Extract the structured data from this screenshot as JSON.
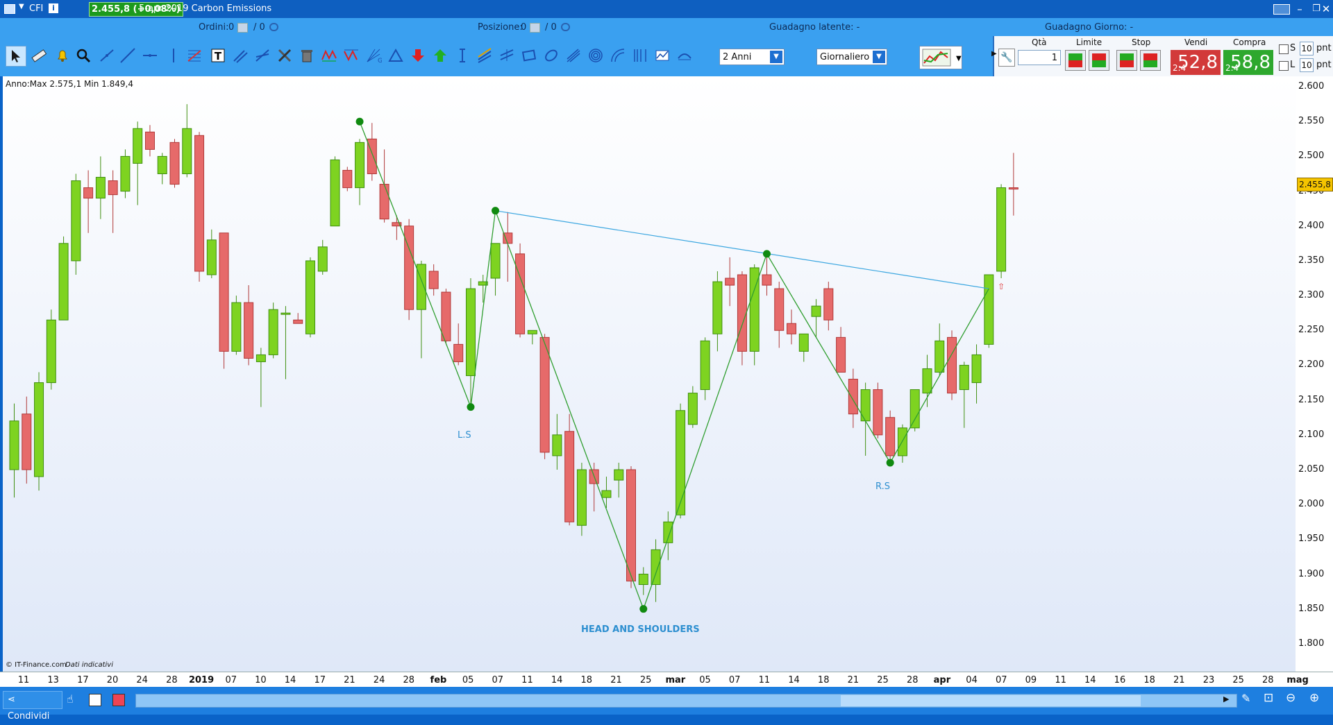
{
  "titlebar": {
    "symbol": "CFI",
    "price_change": "2.455,8 (+0,08%)",
    "instrument": "5-apr-2019 Carbon Emissions"
  },
  "infobar": {
    "orders_label": "Ordini:",
    "orders_value": "0",
    "orders_total": "/ 0",
    "position_label": "Posizione:",
    "position_value": "0",
    "position_total": "/ 0",
    "latent_gain": "Guadagno latente: -",
    "day_gain": "Guadagno Giorno: -"
  },
  "toolbar": {
    "period": "2 Anni",
    "timeframe": "Giornaliero"
  },
  "trade": {
    "qty_label": "Qtà",
    "qty_value": "1",
    "limit_label": "Limite",
    "stop_label": "Stop",
    "sell_label": "Vendi",
    "buy_label": "Compra",
    "sell_prefix": "2.4",
    "sell_price": "52,8",
    "buy_prefix": "2.4",
    "buy_price": "58,8",
    "s_label": "S",
    "l_label": "L",
    "s_pnt": "10",
    "l_pnt": "10",
    "pnt_label": "pnt"
  },
  "chart": {
    "info": "Anno:Max 2.575,1 Min 1.849,4",
    "copyright": "© IT-Finance.com",
    "disclaimer": "Dati indicativi",
    "last_price": "2.455,8",
    "annotations": {
      "ls": "L.S",
      "rs": "R.S",
      "pattern": "HEAD AND SHOULDERS"
    },
    "colors": {
      "up": "#7ed321",
      "down": "#e66a6a",
      "pattern": "#2f9e2f",
      "neckline": "#3aa6e0"
    }
  },
  "chart_data": {
    "type": "candlestick",
    "y_ticks": [
      "2.600",
      "2.550",
      "2.500",
      "2.450",
      "2.400",
      "2.350",
      "2.300",
      "2.250",
      "2.200",
      "2.150",
      "2.100",
      "2.050",
      "2.000",
      "1.950",
      "1.900",
      "1.850",
      "1.800"
    ],
    "ylim": [
      1760,
      2615
    ],
    "x_ticks": [
      "11",
      "13",
      "17",
      "20",
      "24",
      "28",
      "2019",
      "07",
      "10",
      "14",
      "17",
      "21",
      "24",
      "28",
      "feb",
      "05",
      "07",
      "11",
      "14",
      "18",
      "21",
      "25",
      "mar",
      "05",
      "07",
      "11",
      "14",
      "18",
      "21",
      "25",
      "28",
      "apr",
      "04",
      "07",
      "09",
      "11",
      "14",
      "16",
      "18",
      "21",
      "23",
      "25",
      "28",
      "mag"
    ],
    "candles": [
      {
        "o": 2050,
        "h": 2145,
        "l": 2010,
        "c": 2120
      },
      {
        "o": 2130,
        "h": 2155,
        "l": 2030,
        "c": 2050
      },
      {
        "o": 2040,
        "h": 2190,
        "l": 2020,
        "c": 2175
      },
      {
        "o": 2175,
        "h": 2280,
        "l": 2165,
        "c": 2265
      },
      {
        "o": 2265,
        "h": 2385,
        "l": 2265,
        "c": 2375
      },
      {
        "o": 2350,
        "h": 2475,
        "l": 2330,
        "c": 2465
      },
      {
        "o": 2455,
        "h": 2480,
        "l": 2390,
        "c": 2440
      },
      {
        "o": 2440,
        "h": 2500,
        "l": 2410,
        "c": 2470
      },
      {
        "o": 2465,
        "h": 2480,
        "l": 2390,
        "c": 2445
      },
      {
        "o": 2450,
        "h": 2510,
        "l": 2440,
        "c": 2500
      },
      {
        "o": 2490,
        "h": 2550,
        "l": 2430,
        "c": 2540
      },
      {
        "o": 2535,
        "h": 2545,
        "l": 2500,
        "c": 2510
      },
      {
        "o": 2475,
        "h": 2505,
        "l": 2460,
        "c": 2500
      },
      {
        "o": 2520,
        "h": 2525,
        "l": 2455,
        "c": 2460
      },
      {
        "o": 2475,
        "h": 2575,
        "l": 2470,
        "c": 2540
      },
      {
        "o": 2530,
        "h": 2535,
        "l": 2320,
        "c": 2335
      },
      {
        "o": 2330,
        "h": 2395,
        "l": 2325,
        "c": 2380
      },
      {
        "o": 2390,
        "h": 2390,
        "l": 2195,
        "c": 2220
      },
      {
        "o": 2220,
        "h": 2300,
        "l": 2215,
        "c": 2290
      },
      {
        "o": 2290,
        "h": 2315,
        "l": 2200,
        "c": 2210
      },
      {
        "o": 2205,
        "h": 2225,
        "l": 2140,
        "c": 2215
      },
      {
        "o": 2215,
        "h": 2290,
        "l": 2210,
        "c": 2280
      },
      {
        "o": 2275,
        "h": 2285,
        "l": 2180,
        "c": 2275
      },
      {
        "o": 2265,
        "h": 2275,
        "l": 2260,
        "c": 2260
      },
      {
        "o": 2245,
        "h": 2355,
        "l": 2240,
        "c": 2350
      },
      {
        "o": 2335,
        "h": 2380,
        "l": 2330,
        "c": 2370
      },
      {
        "o": 2400,
        "h": 2500,
        "l": 2400,
        "c": 2495
      },
      {
        "o": 2480,
        "h": 2485,
        "l": 2450,
        "c": 2455
      },
      {
        "o": 2455,
        "h": 2525,
        "l": 2430,
        "c": 2520
      },
      {
        "o": 2525,
        "h": 2548,
        "l": 2465,
        "c": 2475
      },
      {
        "o": 2460,
        "h": 2510,
        "l": 2405,
        "c": 2410
      },
      {
        "o": 2405,
        "h": 2415,
        "l": 2380,
        "c": 2400
      },
      {
        "o": 2400,
        "h": 2410,
        "l": 2265,
        "c": 2280
      },
      {
        "o": 2280,
        "h": 2350,
        "l": 2210,
        "c": 2345
      },
      {
        "o": 2335,
        "h": 2345,
        "l": 2300,
        "c": 2310
      },
      {
        "o": 2305,
        "h": 2310,
        "l": 2230,
        "c": 2235
      },
      {
        "o": 2230,
        "h": 2260,
        "l": 2200,
        "c": 2205
      },
      {
        "o": 2185,
        "h": 2325,
        "l": 2140,
        "c": 2310
      },
      {
        "o": 2315,
        "h": 2330,
        "l": 2290,
        "c": 2320
      },
      {
        "o": 2325,
        "h": 2365,
        "l": 2300,
        "c": 2375
      },
      {
        "o": 2390,
        "h": 2420,
        "l": 2320,
        "c": 2375
      },
      {
        "o": 2360,
        "h": 2375,
        "l": 2240,
        "c": 2245
      },
      {
        "o": 2245,
        "h": 2250,
        "l": 2230,
        "c": 2250
      },
      {
        "o": 2240,
        "h": 2245,
        "l": 2065,
        "c": 2075
      },
      {
        "o": 2070,
        "h": 2130,
        "l": 2050,
        "c": 2100
      },
      {
        "o": 2105,
        "h": 2130,
        "l": 1970,
        "c": 1975
      },
      {
        "o": 1970,
        "h": 2060,
        "l": 1955,
        "c": 2050
      },
      {
        "o": 2050,
        "h": 2060,
        "l": 1990,
        "c": 2030
      },
      {
        "o": 2010,
        "h": 2040,
        "l": 1995,
        "c": 2020
      },
      {
        "o": 2035,
        "h": 2060,
        "l": 2010,
        "c": 2050
      },
      {
        "o": 2050,
        "h": 2055,
        "l": 1880,
        "c": 1890
      },
      {
        "o": 1885,
        "h": 1910,
        "l": 1870,
        "c": 1900
      },
      {
        "o": 1885,
        "h": 1950,
        "l": 1860,
        "c": 1935
      },
      {
        "o": 1945,
        "h": 1990,
        "l": 1920,
        "c": 1975
      },
      {
        "o": 1985,
        "h": 2145,
        "l": 1980,
        "c": 2135
      },
      {
        "o": 2115,
        "h": 2170,
        "l": 2110,
        "c": 2160
      },
      {
        "o": 2165,
        "h": 2240,
        "l": 2150,
        "c": 2235
      },
      {
        "o": 2245,
        "h": 2335,
        "l": 2220,
        "c": 2320
      },
      {
        "o": 2325,
        "h": 2355,
        "l": 2285,
        "c": 2315
      },
      {
        "o": 2330,
        "h": 2335,
        "l": 2200,
        "c": 2220
      },
      {
        "o": 2220,
        "h": 2345,
        "l": 2200,
        "c": 2340
      },
      {
        "o": 2330,
        "h": 2360,
        "l": 2300,
        "c": 2315
      },
      {
        "o": 2310,
        "h": 2320,
        "l": 2225,
        "c": 2250
      },
      {
        "o": 2260,
        "h": 2280,
        "l": 2230,
        "c": 2245
      },
      {
        "o": 2220,
        "h": 2245,
        "l": 2205,
        "c": 2245
      },
      {
        "o": 2270,
        "h": 2295,
        "l": 2240,
        "c": 2285
      },
      {
        "o": 2310,
        "h": 2320,
        "l": 2250,
        "c": 2265
      },
      {
        "o": 2240,
        "h": 2255,
        "l": 2190,
        "c": 2190
      },
      {
        "o": 2180,
        "h": 2195,
        "l": 2110,
        "c": 2130
      },
      {
        "o": 2120,
        "h": 2175,
        "l": 2070,
        "c": 2165
      },
      {
        "o": 2165,
        "h": 2175,
        "l": 2095,
        "c": 2100
      },
      {
        "o": 2125,
        "h": 2135,
        "l": 2055,
        "c": 2070
      },
      {
        "o": 2070,
        "h": 2115,
        "l": 2060,
        "c": 2110
      },
      {
        "o": 2110,
        "h": 2165,
        "l": 2105,
        "c": 2165
      },
      {
        "o": 2160,
        "h": 2215,
        "l": 2140,
        "c": 2195
      },
      {
        "o": 2190,
        "h": 2260,
        "l": 2185,
        "c": 2235
      },
      {
        "o": 2240,
        "h": 2250,
        "l": 2150,
        "c": 2160
      },
      {
        "o": 2165,
        "h": 2205,
        "l": 2110,
        "c": 2200
      },
      {
        "o": 2175,
        "h": 2230,
        "l": 2145,
        "c": 2215
      },
      {
        "o": 2230,
        "h": 2330,
        "l": 2225,
        "c": 2330
      },
      {
        "o": 2335,
        "h": 2460,
        "l": 2325,
        "c": 2455
      },
      {
        "o": 2455,
        "h": 2505,
        "l": 2415,
        "c": 2453
      }
    ],
    "pattern_points": [
      {
        "i": 28,
        "v": 2550
      },
      {
        "i": 37,
        "v": 2140
      },
      {
        "i": 39,
        "v": 2422
      },
      {
        "i": 51,
        "v": 1850
      },
      {
        "i": 61,
        "v": 2360
      },
      {
        "i": 71,
        "v": 2060
      },
      {
        "i": 79,
        "v": 2310
      }
    ],
    "neckline": [
      {
        "i": 39,
        "v": 2422
      },
      {
        "i": 79,
        "v": 2310
      }
    ]
  }
}
